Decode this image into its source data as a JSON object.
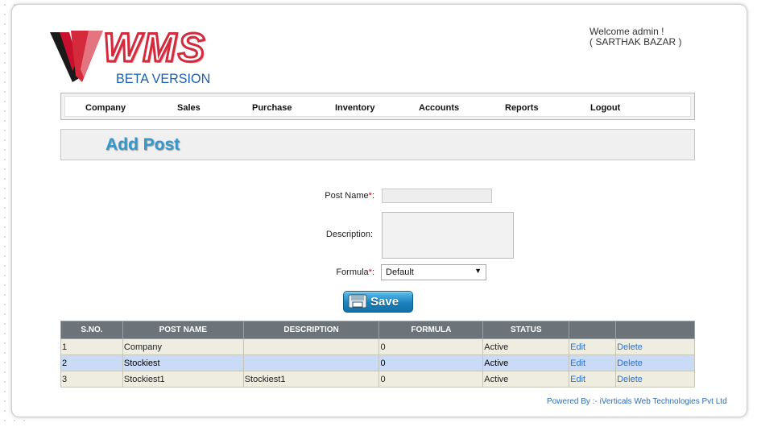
{
  "header": {
    "logo_text": "WMS",
    "logo_subtext": "BETA VERSION",
    "welcome": "Welcome admin !",
    "company": "( SARTHAK BAZAR )"
  },
  "nav": {
    "items": [
      {
        "label": "Company"
      },
      {
        "label": "Sales"
      },
      {
        "label": "Purchase"
      },
      {
        "label": "Inventory"
      },
      {
        "label": "Accounts"
      },
      {
        "label": "Reports"
      },
      {
        "label": "Logout"
      }
    ]
  },
  "page_title": "Add Post",
  "form": {
    "post_name_label": "Post Name",
    "post_name_value": "",
    "description_label": "Description:",
    "description_value": "",
    "formula_label": "Formula",
    "formula_selected": "Default",
    "required_mark": "*",
    "label_colon": ":",
    "save_label": "Save"
  },
  "table": {
    "headers": [
      "S.NO.",
      "POST NAME",
      "DESCRIPTION",
      "FORMULA",
      "STATUS",
      "",
      ""
    ],
    "rows": [
      {
        "sno": "1",
        "post_name": "Company",
        "description": "",
        "formula": "0",
        "status": "Active",
        "edit": "Edit",
        "delete": "Delete"
      },
      {
        "sno": "2",
        "post_name": "Stockiest",
        "description": "",
        "formula": "0",
        "status": "Active",
        "edit": "Edit",
        "delete": "Delete"
      },
      {
        "sno": "3",
        "post_name": "Stockiest1",
        "description": "Stockiest1",
        "formula": "0",
        "status": "Active",
        "edit": "Edit",
        "delete": "Delete"
      }
    ]
  },
  "footer": "Powered By :- iVerticals Web Technologies Pvt Ltd",
  "colors": {
    "accent": "#3399cc",
    "logo_red": "#d42a3c",
    "link": "#2c73c9",
    "table_header": "#6c7479",
    "selected_row": "#c9dbf7"
  }
}
